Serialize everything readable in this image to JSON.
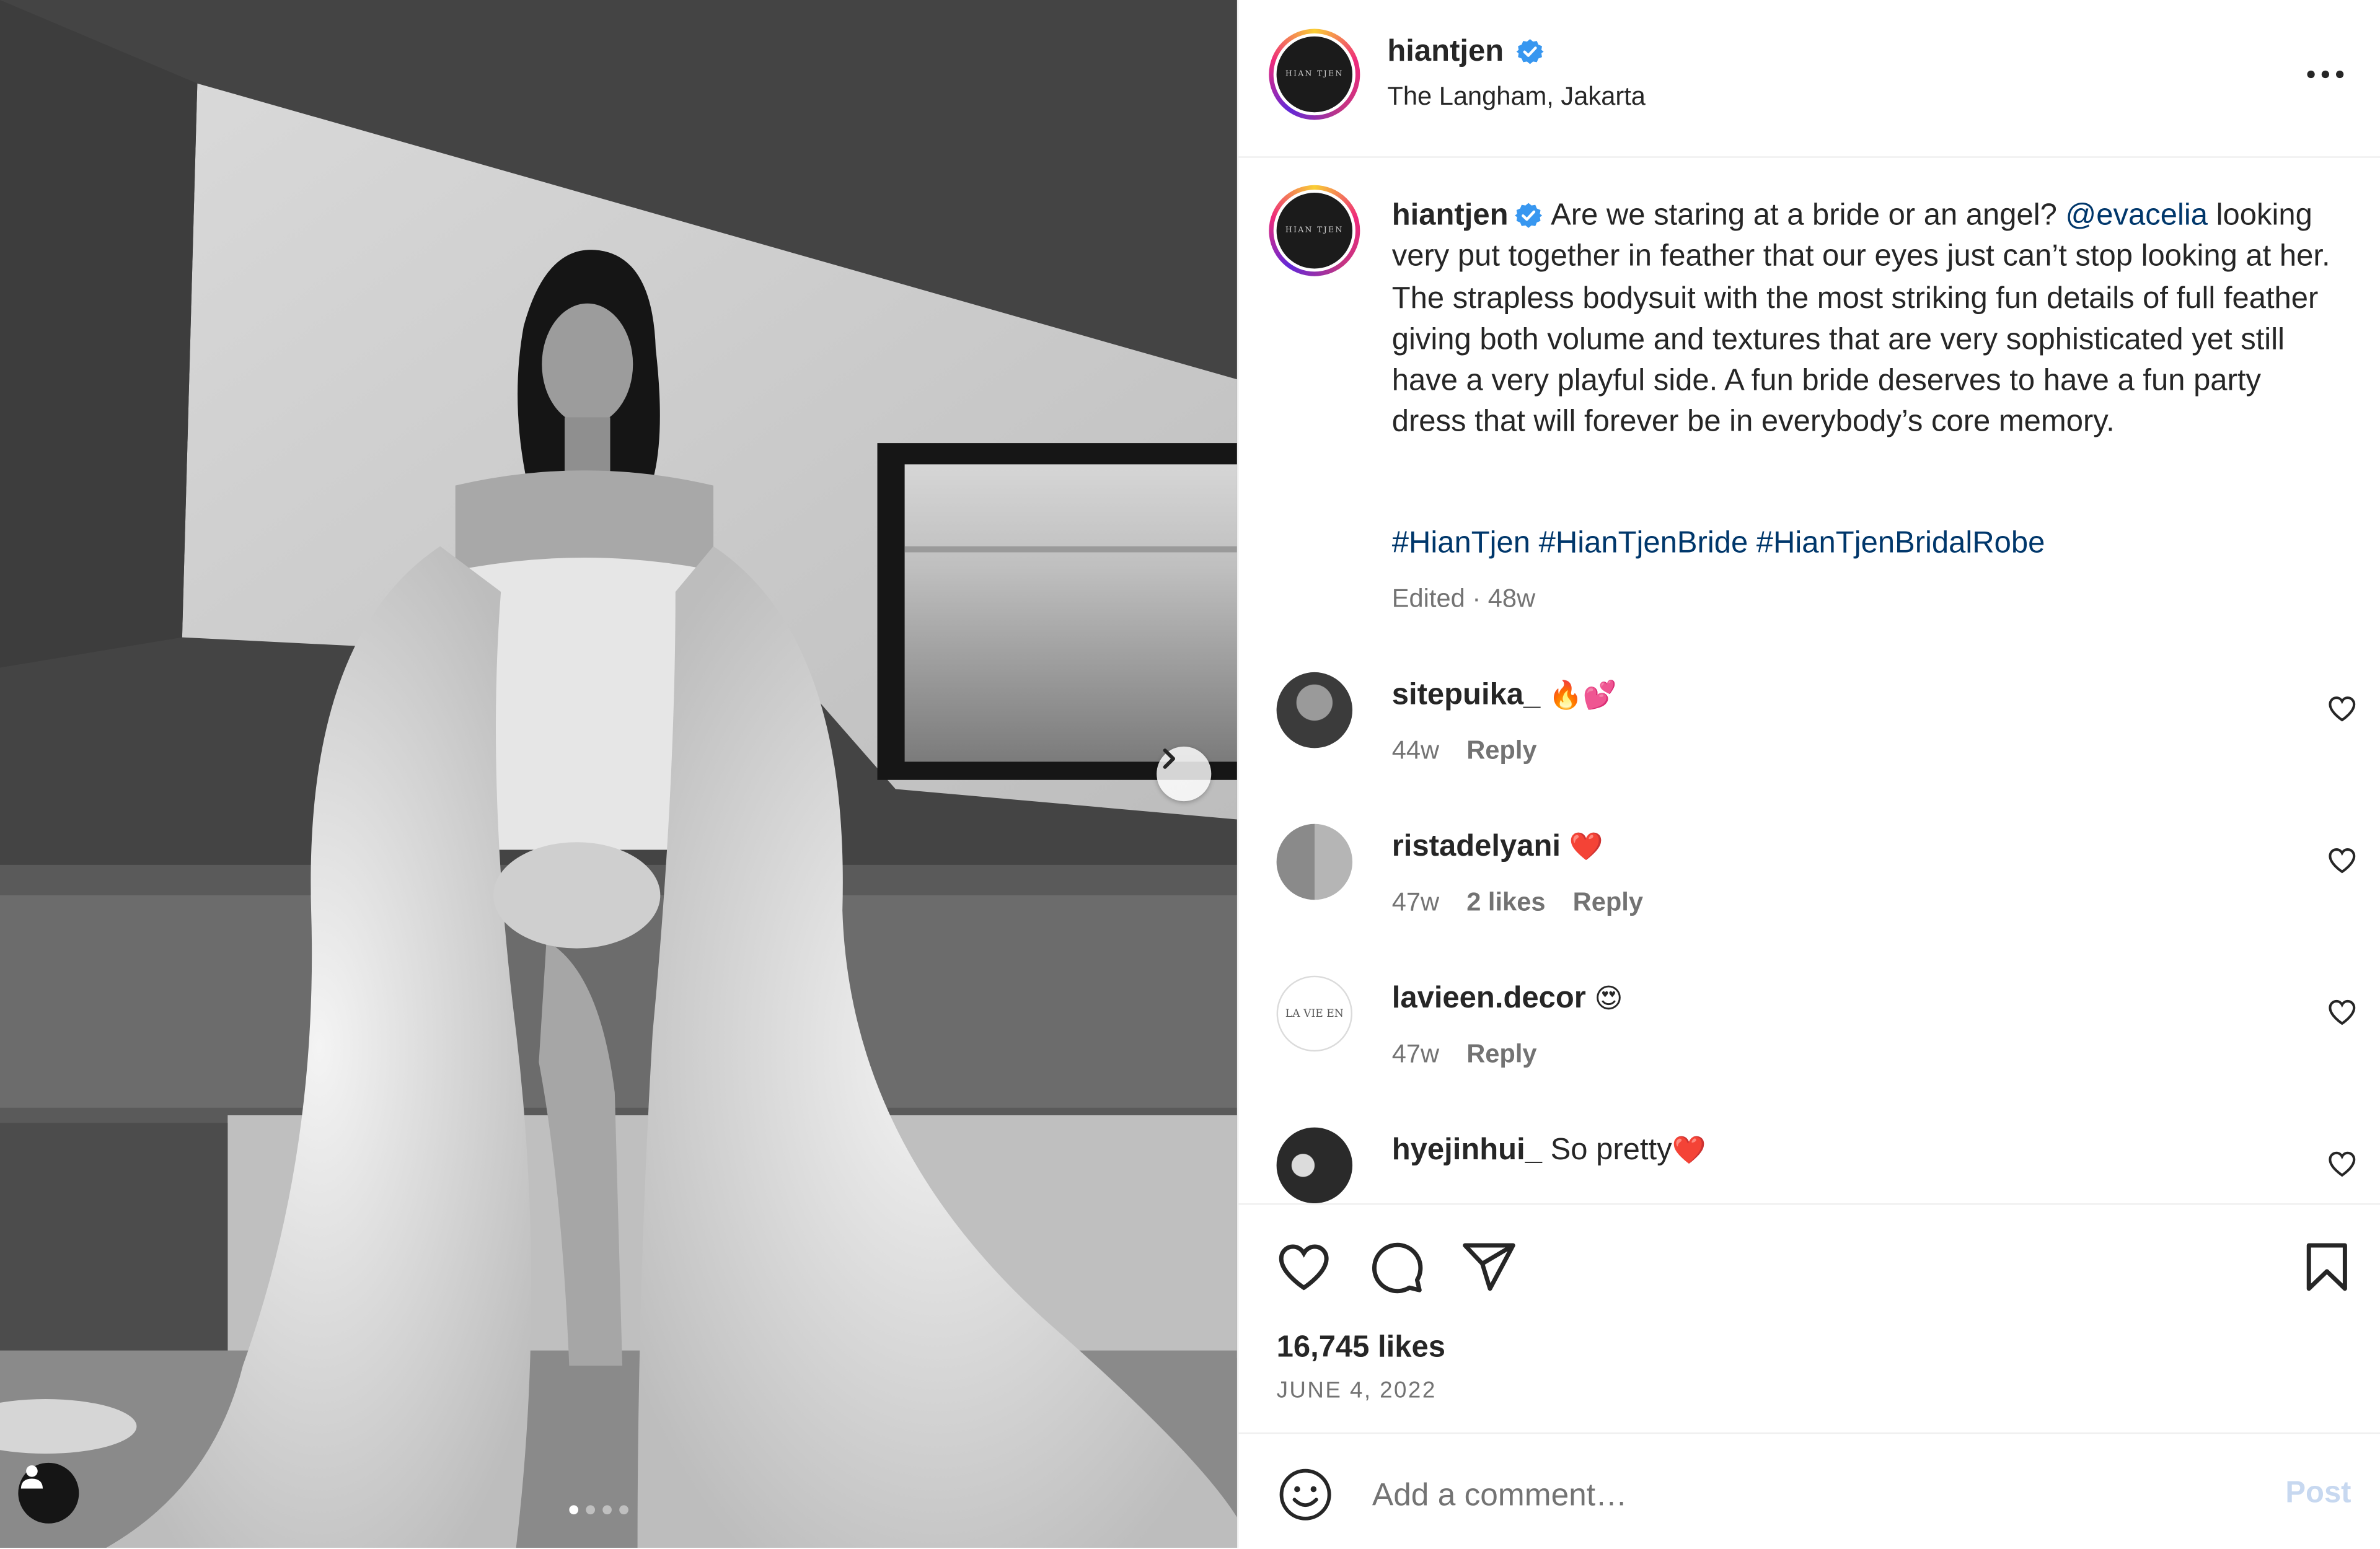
{
  "post": {
    "author": "hiantjen",
    "location": "The Langham, Jakarta",
    "avatar_text": "HIAN TJEN",
    "caption": "Are we staring at a bride or an angel?",
    "mention": "@evacelia",
    "caption_rest": "looking very put together in feather that our eyes just can’t stop looking at her. The strapless bodysuit with the most striking fun details of full feather giving both volume and textures that are very sophisticated yet still have a very playful side. A fun bride deserves to have a fun party dress that will forever be in everybody’s core memory.",
    "hashtags": "#HianTjen #HianTjenBride #HianTjenBridalRobe",
    "edited_label": "Edited · 48w",
    "likes": "16,745 likes",
    "date": "JUNE 4, 2022"
  },
  "carousel": {
    "total": 4,
    "active": 1
  },
  "comments": [
    {
      "user": "sitepuika_",
      "text": "",
      "emoji": "🔥💕",
      "time": "44w",
      "likes": "",
      "reply": "Reply"
    },
    {
      "user": "ristadelyani",
      "text": "",
      "emoji": "❤️",
      "time": "47w",
      "likes": "2 likes",
      "reply": "Reply"
    },
    {
      "user": "lavieen.decor",
      "text": "",
      "emoji": "😍",
      "time": "47w",
      "likes": "",
      "reply": "Reply",
      "avatar_text": "LA VIE EN"
    },
    {
      "user": "hyejinhui_",
      "text": "So pretty",
      "emoji": "❤️",
      "time": "",
      "likes": "",
      "reply": ""
    }
  ],
  "comment_box": {
    "placeholder": "Add a comment…",
    "post_label": "Post"
  },
  "icons": {
    "verified": "verified-badge-icon",
    "more": "more-options-icon",
    "next": "chevron-right-icon",
    "tag": "user-tag-icon",
    "like": "heart-icon",
    "comment": "comment-icon",
    "share": "share-icon",
    "save": "bookmark-icon",
    "emoji": "emoji-icon"
  },
  "colors": {
    "link": "#00376b",
    "verified": "#3897f0",
    "muted": "#737373",
    "post_disabled": "#c7d8f0"
  }
}
